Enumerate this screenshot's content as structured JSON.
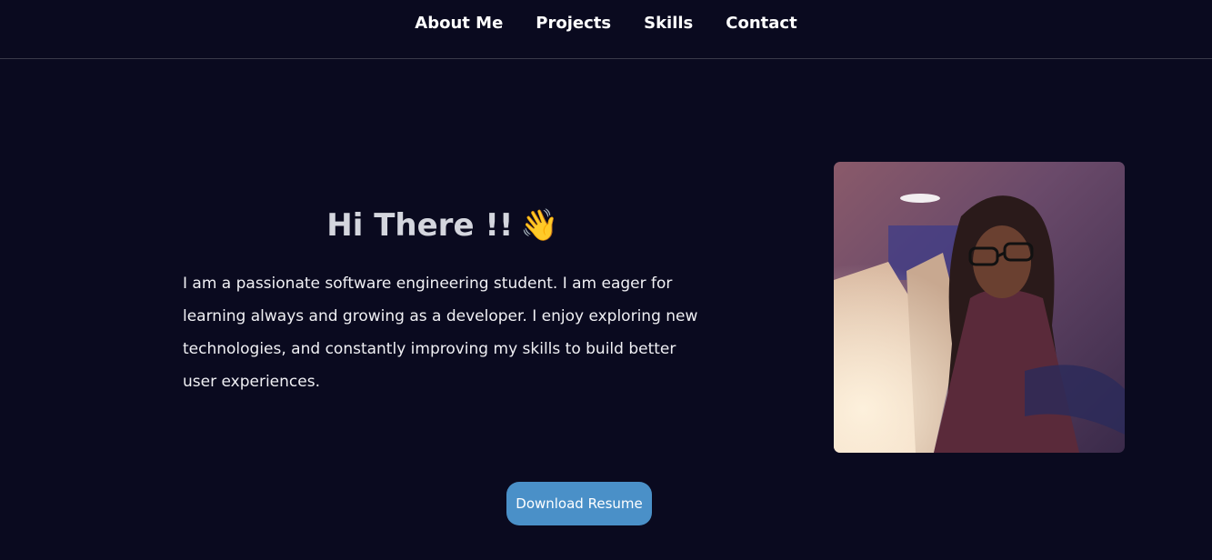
{
  "nav": {
    "items": [
      {
        "label": "About Me"
      },
      {
        "label": "Projects"
      },
      {
        "label": "Skills"
      },
      {
        "label": "Contact"
      }
    ]
  },
  "hero": {
    "title": "Hi There !!",
    "emoji": "👋",
    "description": "I am a passionate software engineering student. I am eager for learning always and growing as a developer. I enjoy exploring new technologies, and constantly improving my skills to build better user experiences.",
    "resume_button": "Download Resume"
  },
  "colors": {
    "background": "#0a0a1f",
    "button": "#4a90c8",
    "title": "#d4d6de"
  }
}
